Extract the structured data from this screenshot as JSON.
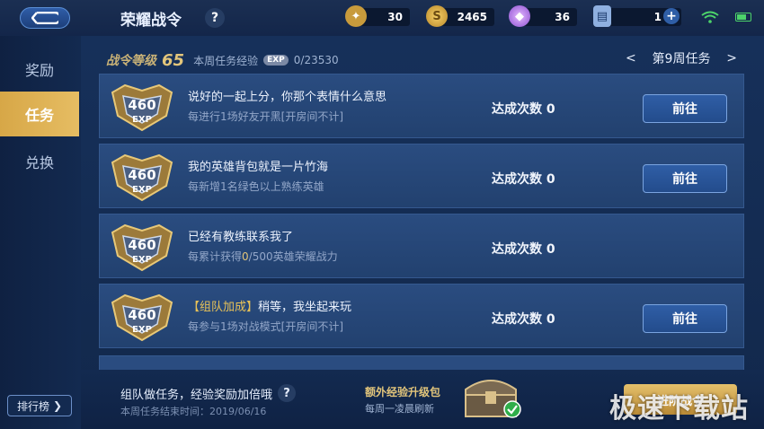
{
  "header": {
    "title": "荣耀战令",
    "help": "?",
    "currencies": [
      {
        "icon": "token-icon",
        "value": "30"
      },
      {
        "icon": "gold-coin-icon",
        "value": "2465"
      },
      {
        "icon": "diamond-icon",
        "value": "36"
      },
      {
        "icon": "ticket-icon",
        "value": "1"
      }
    ],
    "add": "+"
  },
  "sidebar": {
    "items": [
      {
        "label": "奖励"
      },
      {
        "label": "任务"
      },
      {
        "label": "兑换"
      }
    ],
    "rank_button": "排行榜"
  },
  "level": {
    "label": "战令等级",
    "value": "65",
    "exp_label": "本周任务经验",
    "exp_badge": "EXP",
    "exp_value": "0/23530"
  },
  "week": {
    "label": "第9周任务",
    "prev": "<",
    "next": ">"
  },
  "tasks": [
    {
      "reward": "460",
      "reward_unit": "EXP",
      "tag": "",
      "name": "说好的一起上分，你那个表情什么意思",
      "desc_pre": "每进行1场好友开黑[开房间不计]",
      "desc_hl": "",
      "desc_post": "",
      "count": "达成次数 0",
      "button": "前往"
    },
    {
      "reward": "460",
      "reward_unit": "EXP",
      "tag": "",
      "name": "我的英雄背包就是一片竹海",
      "desc_pre": "每新增1名绿色以上熟练英雄",
      "desc_hl": "",
      "desc_post": "",
      "count": "达成次数 0",
      "button": "前往"
    },
    {
      "reward": "460",
      "reward_unit": "EXP",
      "tag": "",
      "name": "已经有教练联系我了",
      "desc_pre": "每累计获得",
      "desc_hl": "0",
      "desc_post": "/500英雄荣耀战力",
      "count": "达成次数 0",
      "button": ""
    },
    {
      "reward": "460",
      "reward_unit": "EXP",
      "tag": "【组队加成】",
      "name": "稍等，我坐起来玩",
      "desc_pre": "每参与1场对战模式[开房间不计]",
      "desc_hl": "",
      "desc_post": "",
      "count": "达成次数 0",
      "button": "前往"
    }
  ],
  "footer": {
    "team_text": "组队做任务，经验奖励加倍哦",
    "help": "?",
    "end_time": "本周任务结束时间：2019/06/16",
    "pack_title": "额外经验升级包",
    "pack_sub": "每周一凌晨刷新",
    "upgrade_button": "进阶战令"
  },
  "watermark": "极速下载站",
  "colors": {
    "accent": "#e6bd63",
    "panel": "#2a4c80",
    "highlight": "#e2c57b",
    "status_green": "#4cd36a"
  }
}
